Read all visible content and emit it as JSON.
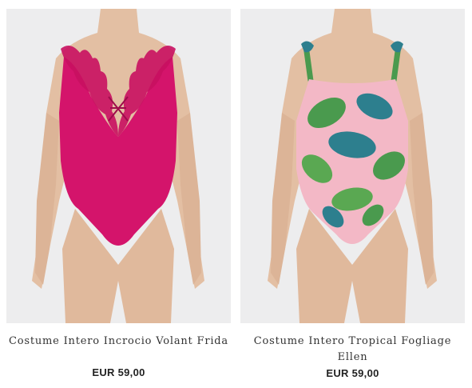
{
  "products": [
    {
      "name": "Costume Intero Incrocio Volant Frida",
      "price": "EUR 59,00",
      "swimsuit_color": "#d4146b",
      "image_icon": "swimsuit-photo-icon"
    },
    {
      "name": "Costume Intero Tropical Fogliage Ellen",
      "price": "EUR 59,00",
      "swimsuit_color": "#f3b8c6",
      "image_icon": "swimsuit-photo-icon"
    }
  ],
  "colors": {
    "photo_background": "#ededee",
    "skin": "#e3bfa3",
    "leaf_green": "#4a9a4e",
    "leaf_teal": "#2d7f8e"
  }
}
